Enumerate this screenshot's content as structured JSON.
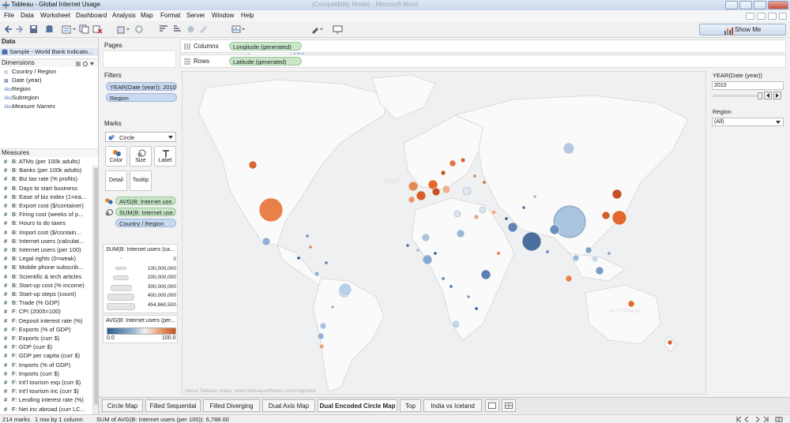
{
  "window": {
    "title": "Tableau - Global Internet Usage",
    "blurred_title": "(Compatibility Mode) - Microsoft Word"
  },
  "menu": [
    "File",
    "Data",
    "Worksheet",
    "Dashboard",
    "Analysis",
    "Map",
    "Format",
    "Server",
    "Window",
    "Help"
  ],
  "toolbar": {
    "abc_label": "Abc",
    "show_me_label": "Show Me"
  },
  "data_pane": {
    "header": "Data",
    "datasource": "Sample - World Bank Indicato...",
    "dimensions_header": "Dimensions",
    "dimensions": [
      {
        "icon": "globe-icon",
        "label": "Country / Region"
      },
      {
        "icon": "calendar-icon",
        "label": "Date (year)"
      },
      {
        "icon": "abc-icon",
        "label": "Region"
      },
      {
        "icon": "abc-icon",
        "label": "Subregion"
      },
      {
        "icon": "abc-icon",
        "label": "Measure Names"
      }
    ],
    "measures_header": "Measures",
    "measures": [
      "B: ATMs (per 100k adults)",
      "B: Banks (per 100k adults)",
      "B: Biz tax rate (% profits)",
      "B: Days to start business",
      "B: Ease of biz index (1=ea...",
      "B: Export cost ($/container)",
      "B: Firing cost (weeks of p...",
      "B: Hours to do taxes",
      "B: Import cost ($/contain...",
      "B: Internet users (calculat...",
      "B: Internet users (per 100)",
      "B: Legal rights (0=weak)",
      "B: Mobile phone subscrib...",
      "B: Scientific & tech articles",
      "B: Start-up cost (% income)",
      "B: Start-up steps (count)",
      "B: Trade (% GDP)",
      "F: CPI (2005=100)",
      "F: Deposit interest rate (%)",
      "F: Exports (% of GDP)",
      "F: Exports (curr $)",
      "F: GDP (curr $)",
      "F: GDP per capita (curr $)",
      "F: Imports (% of GDP)",
      "F: Imports (curr $)",
      "F: Int'l tourism exp (curr $)",
      "F: Int'l tourism inc (curr $)",
      "F: Lending interest rate (%)",
      "F: Net inc abroad (curr LC..."
    ]
  },
  "shelves": {
    "pages_label": "Pages",
    "filters_label": "Filters",
    "filters": [
      "YEAR(Date (year)): 2010",
      "Region"
    ],
    "columns_label": "Columns",
    "columns_pill": "Longitude (generated)",
    "rows_label": "Rows",
    "rows_pill": "Latitude (generated)"
  },
  "marks": {
    "label": "Marks",
    "type": "Circle",
    "buttons": [
      "Color",
      "Size",
      "Label",
      "Detail",
      "Tooltip"
    ],
    "pills": [
      "AVG(B: Internet use...",
      "SUM(B: Internet use...",
      "Country / Region"
    ]
  },
  "size_legend": {
    "title": "SUM(B: Internet users (ca...",
    "values": [
      "0",
      "100,000,000",
      "200,000,000",
      "300,000,000",
      "400,000,000",
      "454,860,500"
    ]
  },
  "color_legend": {
    "title": "AVG(B: Internet users (per...",
    "min": "0.0",
    "max": "100.0",
    "low_color": "#2b5a8e",
    "high_color": "#c9541b"
  },
  "map": {
    "attribution": "About Tableau maps: www.tableausoftware.com/mapdata",
    "watermark_united": "UNIT",
    "watermark_australia": "AUSTRALIA"
  },
  "quick_filters": {
    "year_title": "YEAR(Date (year))",
    "year_value": "2010",
    "region_title": "Region",
    "region_value": "(All)"
  },
  "tabs": [
    "Circle Map",
    "Filled Sequential",
    "Filled Diverging",
    "Dual Axis Map",
    "Dual Encoded Circle Map",
    "Top",
    "India vs Iceland"
  ],
  "active_tab": "Dual Encoded Circle Map",
  "status": {
    "marks": "214 marks",
    "rows_cols": "1 row by 1 column",
    "sum": "SUM of AVG(B: Internet users (per 100)): 6,788.00"
  }
}
